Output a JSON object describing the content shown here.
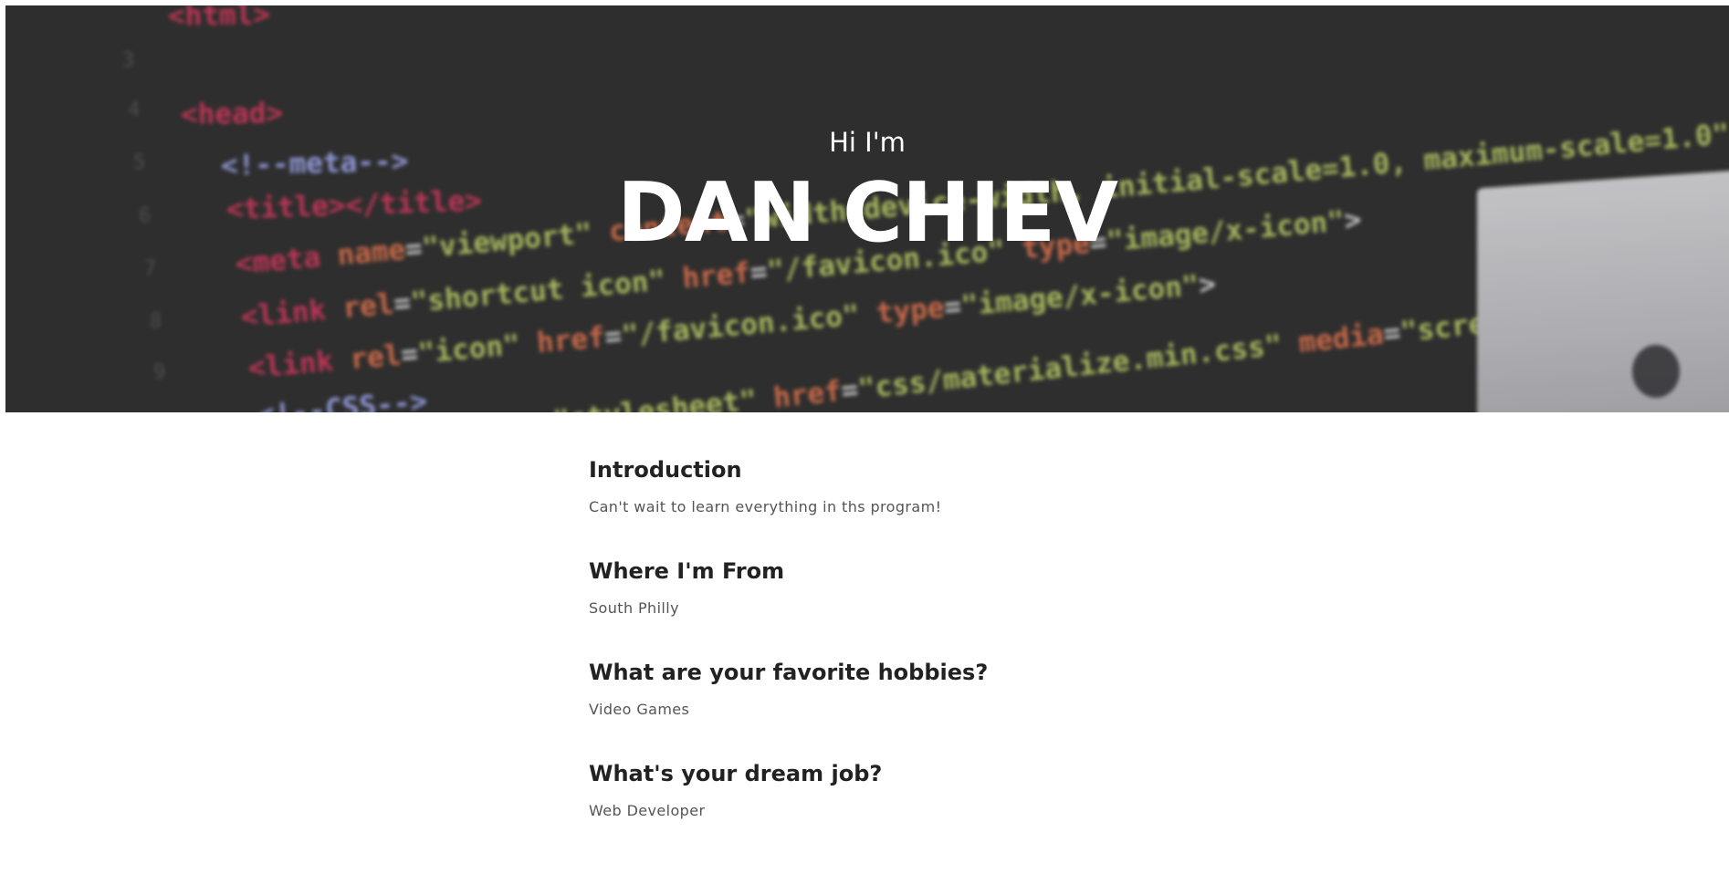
{
  "hero": {
    "greeting": "Hi I'm",
    "name": "DAN CHIEV"
  },
  "sections": [
    {
      "heading": "Introduction",
      "text": "Can't wait to learn everything in ths program!"
    },
    {
      "heading": "Where I'm From",
      "text": "South Philly"
    },
    {
      "heading": "What are your favorite hobbies?",
      "text": "Video Games"
    },
    {
      "heading": "What's your dream job?",
      "text": "Web Developer"
    }
  ],
  "colors": {
    "hero_background": "#333333",
    "page_background": "#ffffff",
    "heading_text": "#222222",
    "body_text": "#555555"
  }
}
